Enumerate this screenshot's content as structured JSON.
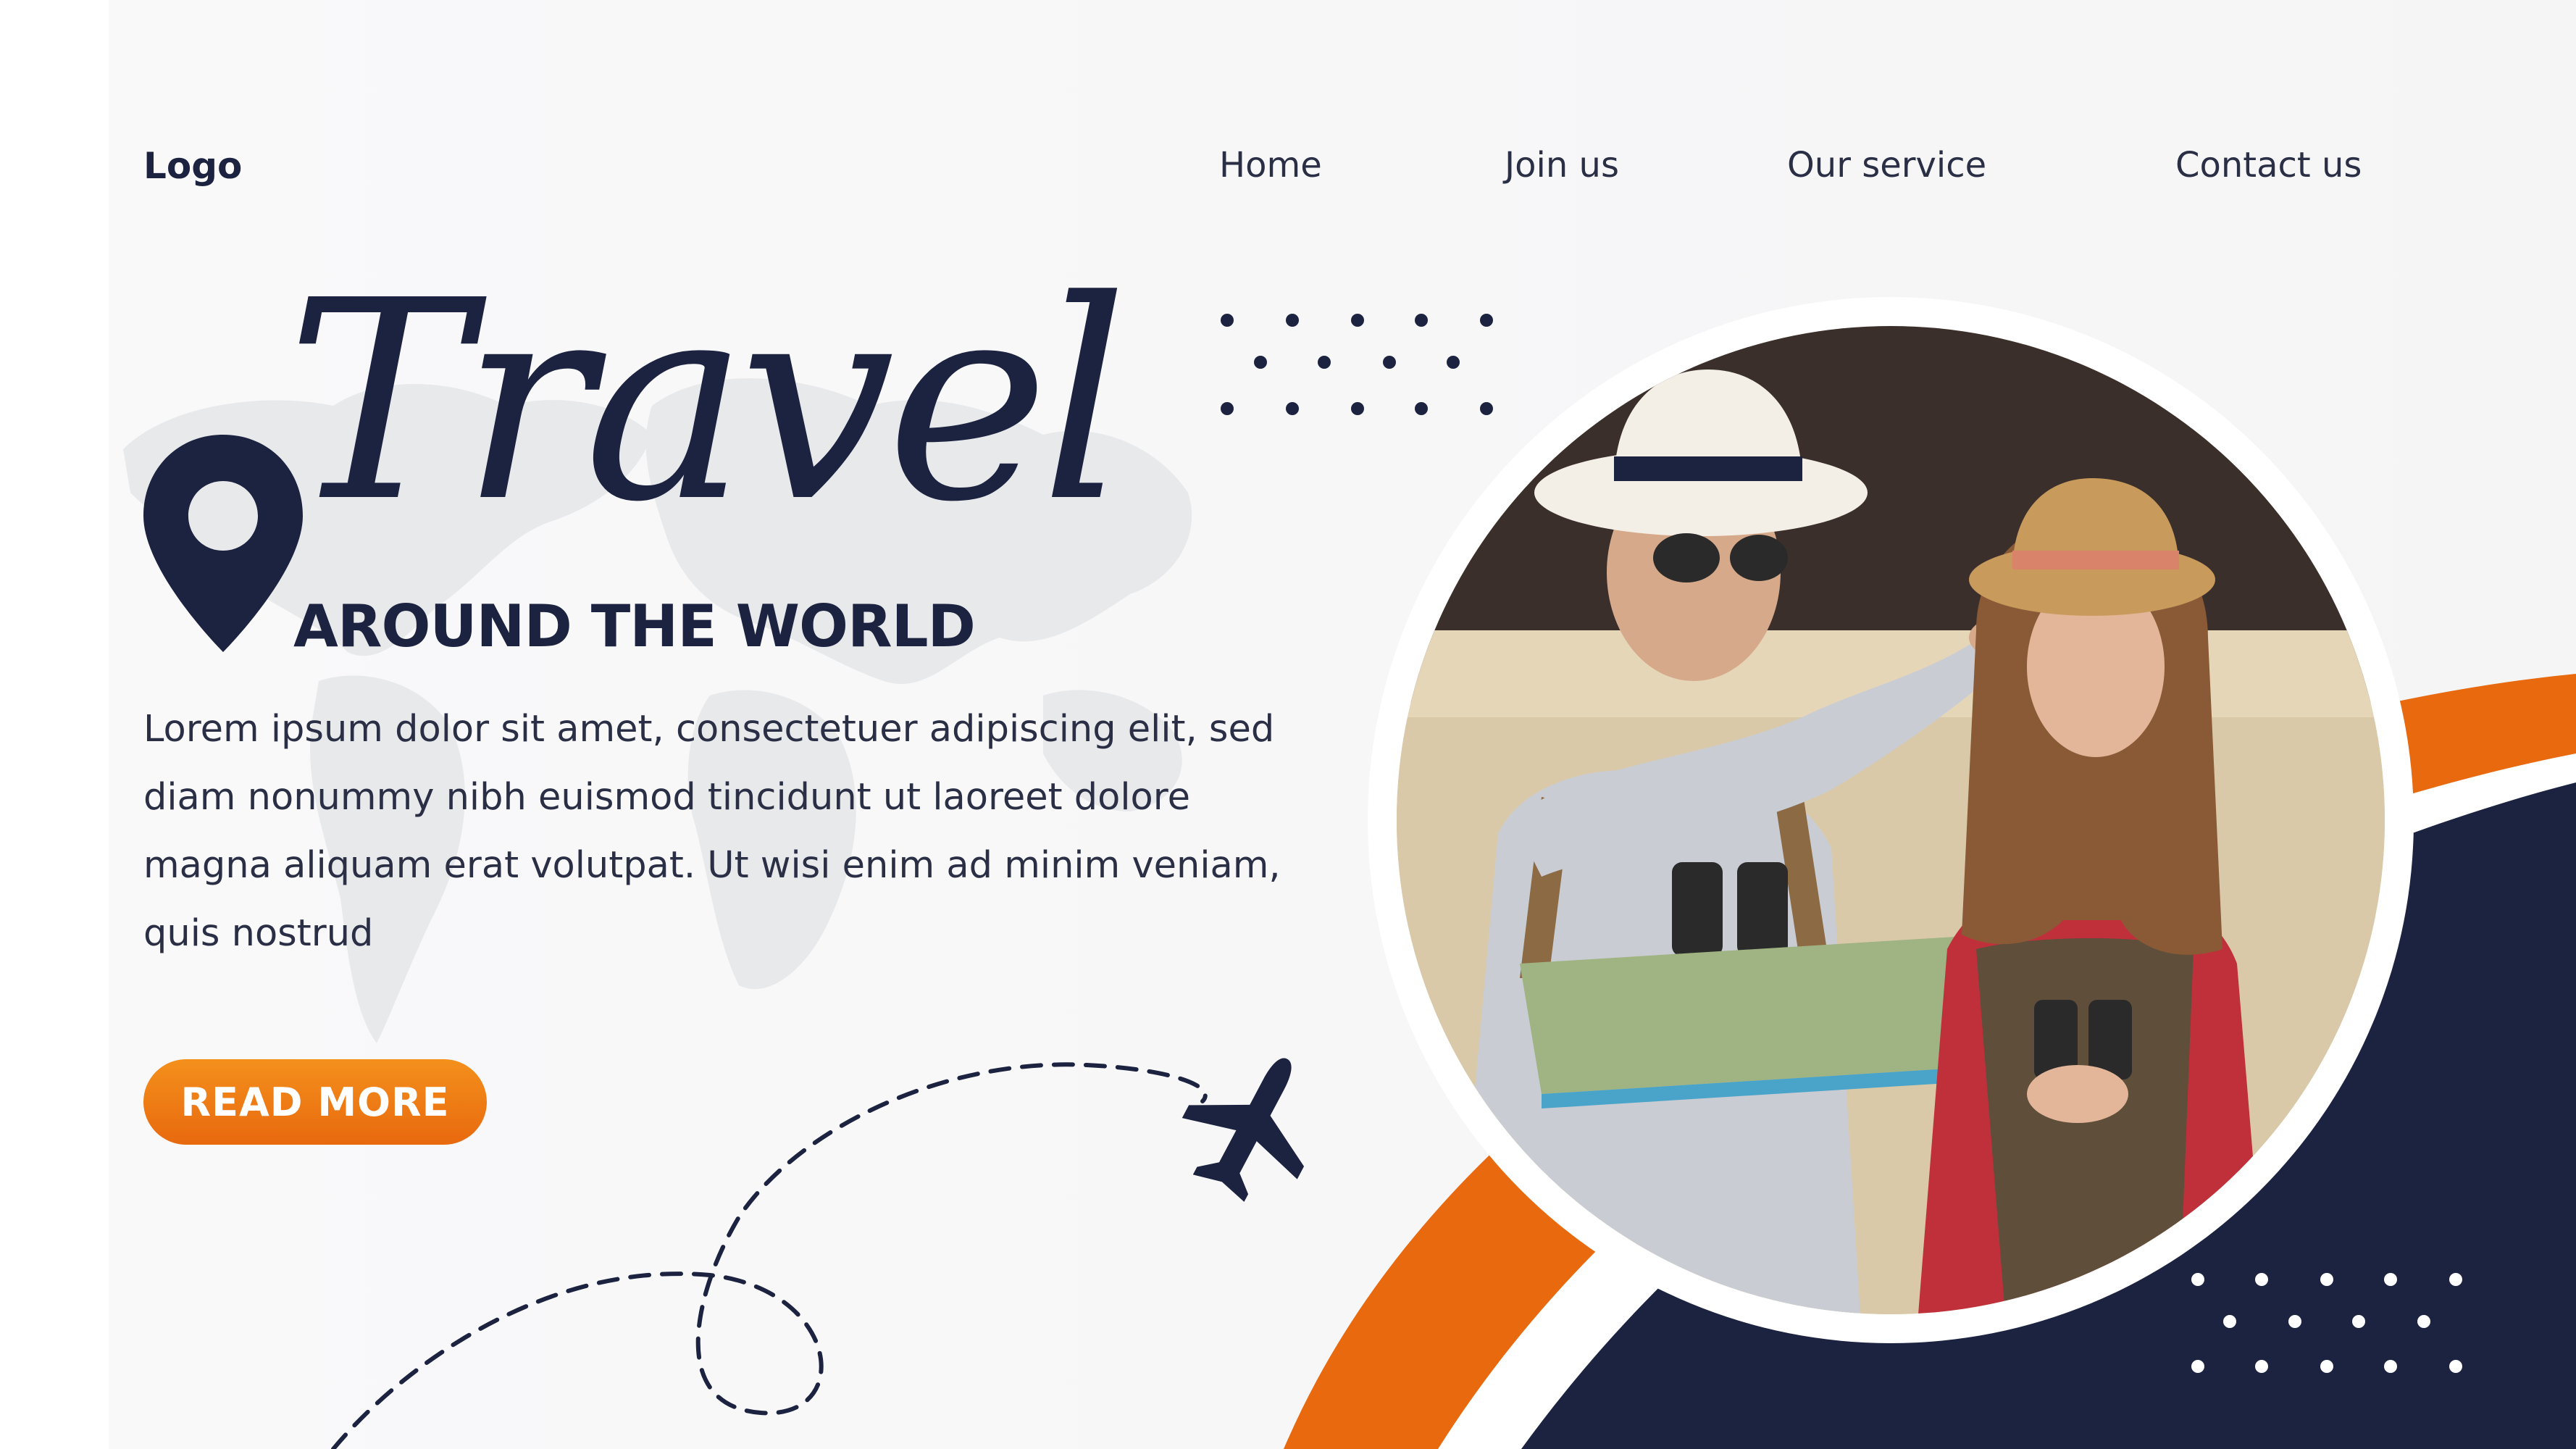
{
  "header": {
    "logo": "Logo",
    "nav": [
      "Home",
      "Join us",
      "Our service",
      "Contact us"
    ]
  },
  "hero": {
    "title": "Travel",
    "subtitle": "AROUND THE WORLD",
    "description": "Lorem ipsum dolor sit amet, consectetuer adipiscing elit, sed diam nonummy nibh euismod tincidunt ut laoreet dolore magna aliquam erat volutpat. Ut wisi enim ad minim veniam, quis nostrud",
    "cta": "READ MORE"
  },
  "icons": [
    "location-pin-icon",
    "airplane-icon"
  ],
  "colors": {
    "navy": "#1c2340",
    "orange": "#e8690e",
    "orange_light": "#f4901c",
    "background": "#f7f7f8",
    "map": "#e8e9eb"
  }
}
